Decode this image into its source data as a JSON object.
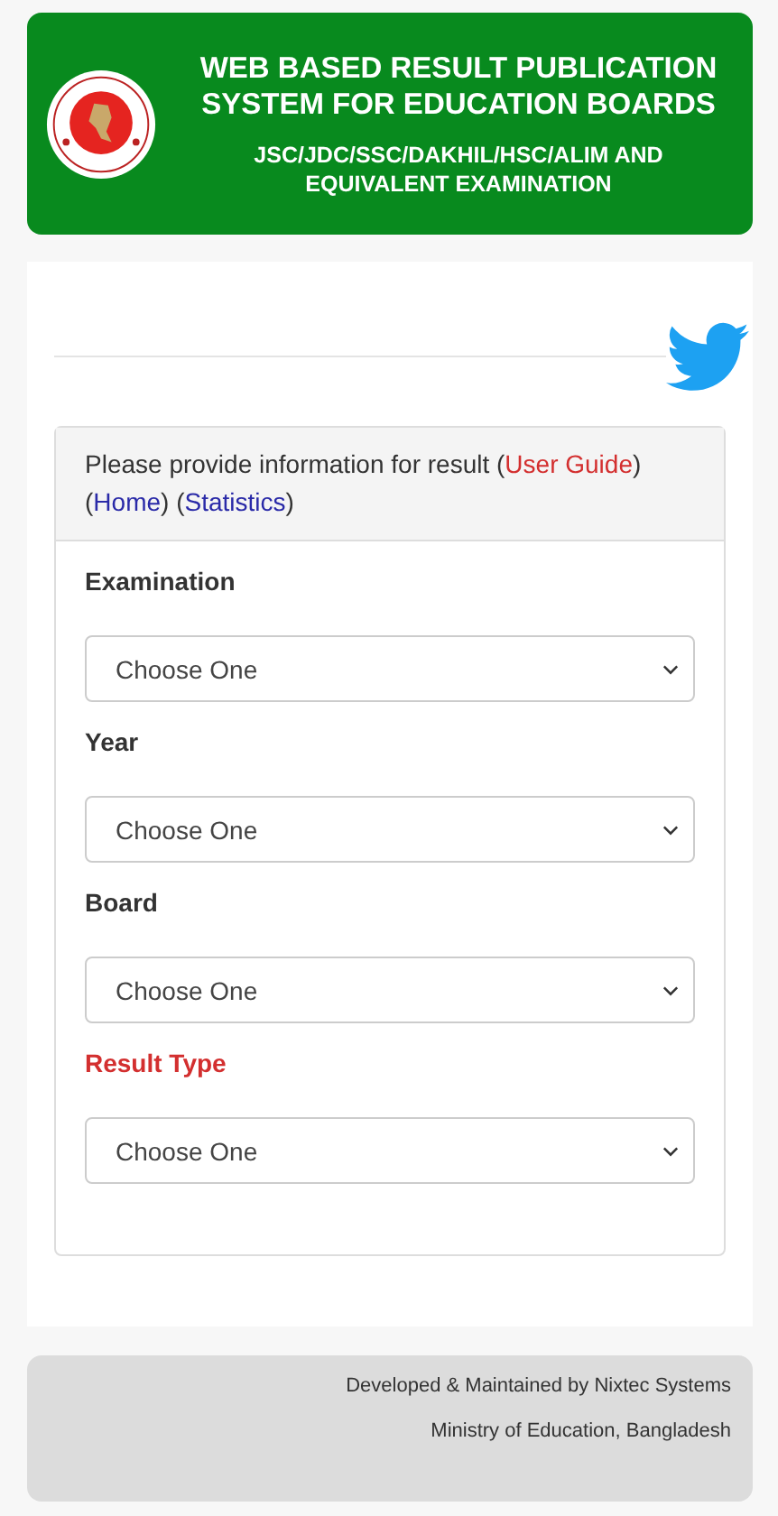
{
  "header": {
    "title": "WEB BASED RESULT PUBLICATION SYSTEM FOR EDUCATION BOARDS",
    "subtitle": "JSC/JDC/SSC/DAKHIL/HSC/ALIM AND EQUIVALENT EXAMINATION"
  },
  "intro": [
    {
      "text": "Please provide information for result ("
    },
    {
      "text": "User Guide",
      "link": true,
      "color": "#d32f2f"
    },
    {
      "text": ") ("
    },
    {
      "text": "Home",
      "link": true,
      "color": "#2a2aa8"
    },
    {
      "text": ") ("
    },
    {
      "text": "Statistics",
      "link": true,
      "color": "#2a2aa8"
    },
    {
      "text": ")"
    }
  ],
  "fields": [
    {
      "label": "Examination",
      "highlighted": false,
      "placeholder": "Choose One"
    },
    {
      "label": "Year",
      "highlighted": false,
      "placeholder": "Choose One"
    },
    {
      "label": "Board",
      "highlighted": false,
      "placeholder": "Choose One"
    },
    {
      "label": "Result Type",
      "highlighted": true,
      "placeholder": "Choose One"
    }
  ],
  "footer": [
    "Developed & Maintained by Nixtec Systems",
    "Ministry of Education, Bangladesh"
  ]
}
